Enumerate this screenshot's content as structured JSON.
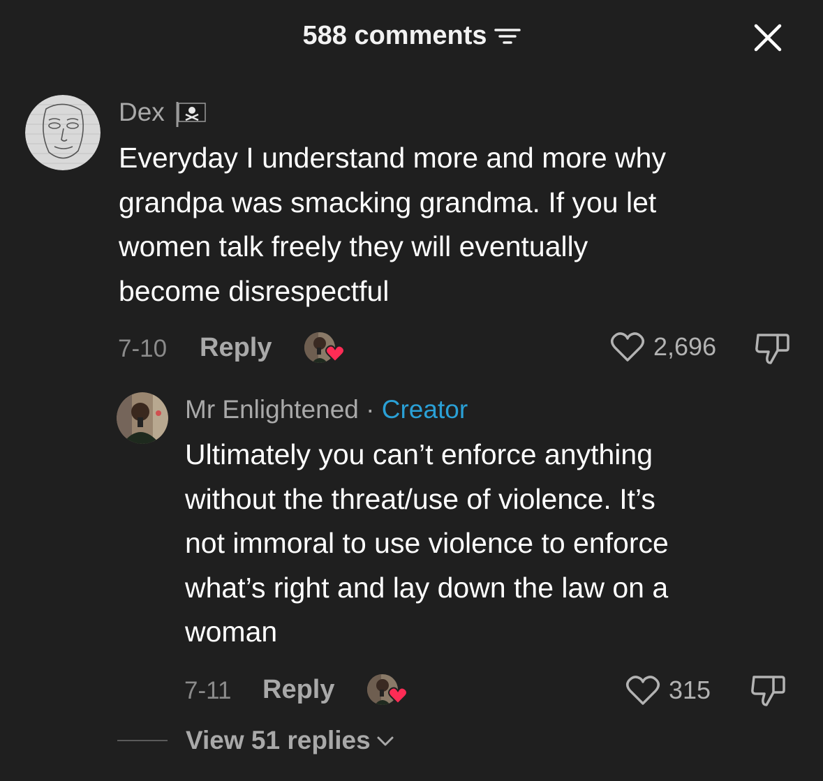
{
  "header": {
    "title": "588 comments"
  },
  "comments": [
    {
      "username": "Dex",
      "badge": "🏴‍☠️",
      "text_lines": [
        "Everyday I understand more and more why",
        "grandpa was smacking grandma. If you let",
        "women talk freely they will eventually",
        "become disrespectful"
      ],
      "date": "7-10",
      "reply_label": "Reply",
      "likes": "2,696"
    },
    {
      "username": "Mr Enlightened",
      "separator": " · ",
      "creator_label": "Creator",
      "text_lines": [
        "Ultimately you can’t enforce anything",
        "without the threat/use of violence. It’s",
        "not immoral to use violence to enforce",
        "what’s right and lay down the law on a",
        "woman"
      ],
      "date": "7-11",
      "reply_label": "Reply",
      "likes": "315"
    }
  ],
  "view_replies": {
    "label": "View 51 replies"
  },
  "colors": {
    "background": "#1f1f1f",
    "creator": "#2aa0d6",
    "heart_badge": "#fe2c55",
    "muted": "#a9a9a9"
  }
}
